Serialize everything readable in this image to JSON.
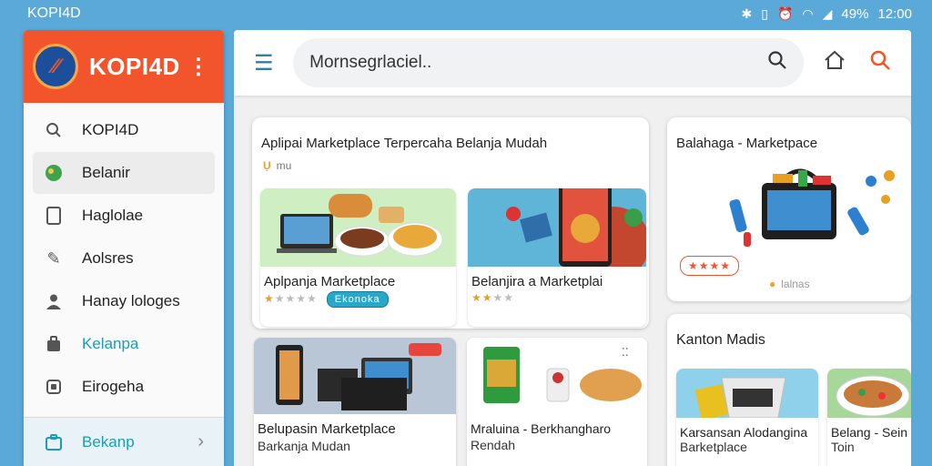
{
  "status_bar": {
    "app_label": "KOPI4D",
    "battery": "49%",
    "time": "12:00"
  },
  "sidebar": {
    "brand": "KOPI4D",
    "items": [
      {
        "label": "KOPI4D",
        "icon": "search-icon"
      },
      {
        "label": "Belanir",
        "icon": "globe-icon"
      },
      {
        "label": "Haglolae",
        "icon": "tablet-icon"
      },
      {
        "label": "Aolsres",
        "icon": "pencil-icon"
      },
      {
        "label": "Hanay lologes",
        "icon": "user-icon"
      },
      {
        "label": "Kelanpa",
        "icon": "bag-icon"
      },
      {
        "label": "Eirogeha",
        "icon": "document-icon"
      }
    ],
    "footer_label": "Bekanp"
  },
  "topbar": {
    "search_value": "Mornsegrlaciel.."
  },
  "feature_card": {
    "title": "Aplipai Marketplace Terpercaha Belanja Mudah",
    "meta": "mu",
    "items": [
      {
        "title": "Aplpanja Marketplace",
        "rating": 1,
        "badge": "Ekonoka"
      },
      {
        "title": "Belanjira a Marketplai",
        "rating": 2,
        "badge": ""
      }
    ]
  },
  "right_card": {
    "title": "Balahaga - Marketpace",
    "tag": "★★★★",
    "meta": "lalnas"
  },
  "lower_cards": [
    {
      "title": "Belupasin Marketplace",
      "subtitle": "Barkanja Mudan"
    },
    {
      "title": "Mraluina - Berkhangharo",
      "subtitle": "Rendah"
    }
  ],
  "bottom_right_card": {
    "title": "Kanton Madis",
    "items": [
      {
        "title": "Karsansan Alodangina",
        "subtitle": "Barketplace"
      },
      {
        "title": "Belang - Sein",
        "subtitle": "Toin"
      }
    ]
  },
  "colors": {
    "accent": "#f2552c",
    "teal": "#1d9bb3",
    "background": "#5aa9d8"
  }
}
